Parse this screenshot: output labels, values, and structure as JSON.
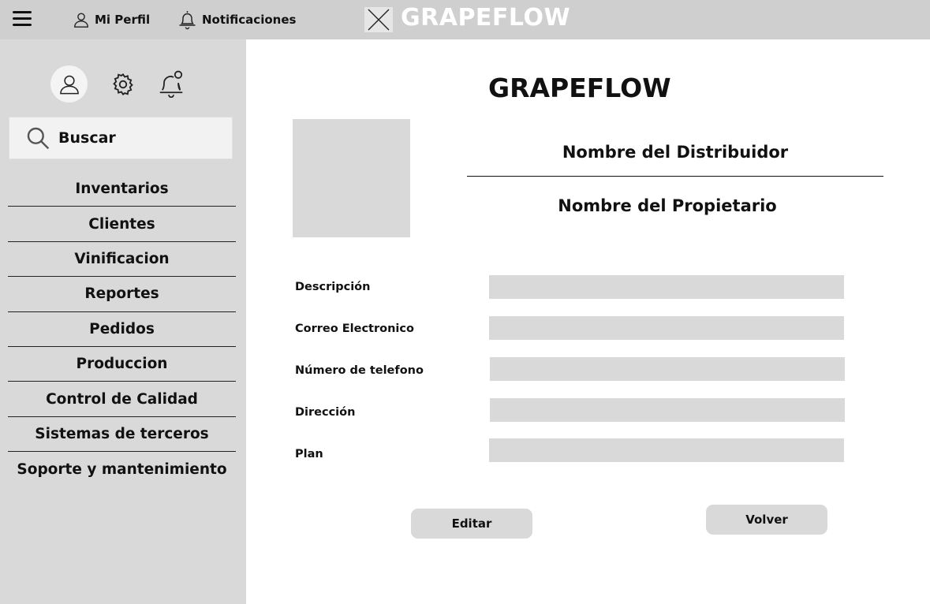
{
  "topbar": {
    "menu_icon": "hamburger-menu-icon",
    "profile_label": "Mi Perfil",
    "profile_icon": "user-icon",
    "notifications_label": "Notificaciones",
    "notifications_icon": "bell-icon",
    "logo_icon": "image-placeholder-icon",
    "brand": "GRAPEFLOW"
  },
  "sidebar": {
    "icons": [
      "user-icon",
      "gear-icon",
      "bell-notification-icon"
    ],
    "search_label": "Buscar",
    "search_icon": "search-icon",
    "items": [
      {
        "label": "Inventarios"
      },
      {
        "label": "Clientes"
      },
      {
        "label": "Vinificacion"
      },
      {
        "label": "Reportes"
      },
      {
        "label": "Pedidos"
      },
      {
        "label": "Produccion"
      },
      {
        "label": "Control de Calidad"
      },
      {
        "label": "Sistemas de terceros"
      },
      {
        "label": "Soporte y mantenimiento"
      }
    ]
  },
  "main": {
    "title": "GRAPEFLOW",
    "distributor_name": "Nombre del Distribuidor",
    "owner_name": "Nombre del Propietario",
    "fields": [
      {
        "label": "Descripción",
        "value": ""
      },
      {
        "label": "Correo Electronico",
        "value": ""
      },
      {
        "label": "Número de telefono",
        "value": ""
      },
      {
        "label": "Dirección",
        "value": ""
      },
      {
        "label": "Plan",
        "value": ""
      }
    ],
    "edit_button": "Editar",
    "back_button": "Volver"
  },
  "colors": {
    "topbar_bg": "#cfcfcf",
    "sidebar_bg": "#d9d9d9",
    "field_bg": "#d9d9d9",
    "brand_text": "#ffffff"
  }
}
